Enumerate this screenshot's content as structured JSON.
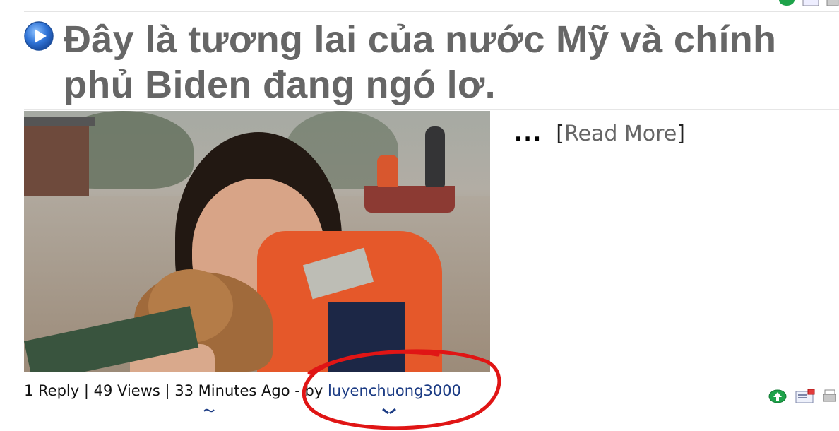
{
  "post": {
    "title": "Đây là tương lai của nước Mỹ và chính phủ Biden đang ngó lơ.",
    "excerpt_dots": "...",
    "read_more": "Read More",
    "replies": "1 Reply",
    "views": "49 Views",
    "time": "33 Minutes Ago",
    "by_label": "- by",
    "author": "luyenchuong3000"
  },
  "icons": {
    "title": "play-circle-icon",
    "actions": [
      "vote-up-icon",
      "email-icon",
      "print-icon"
    ]
  },
  "colors": {
    "title": "#666666",
    "author_link": "#1b3b84",
    "annotation": "#e01515",
    "vote_green": "#1ea34a"
  }
}
